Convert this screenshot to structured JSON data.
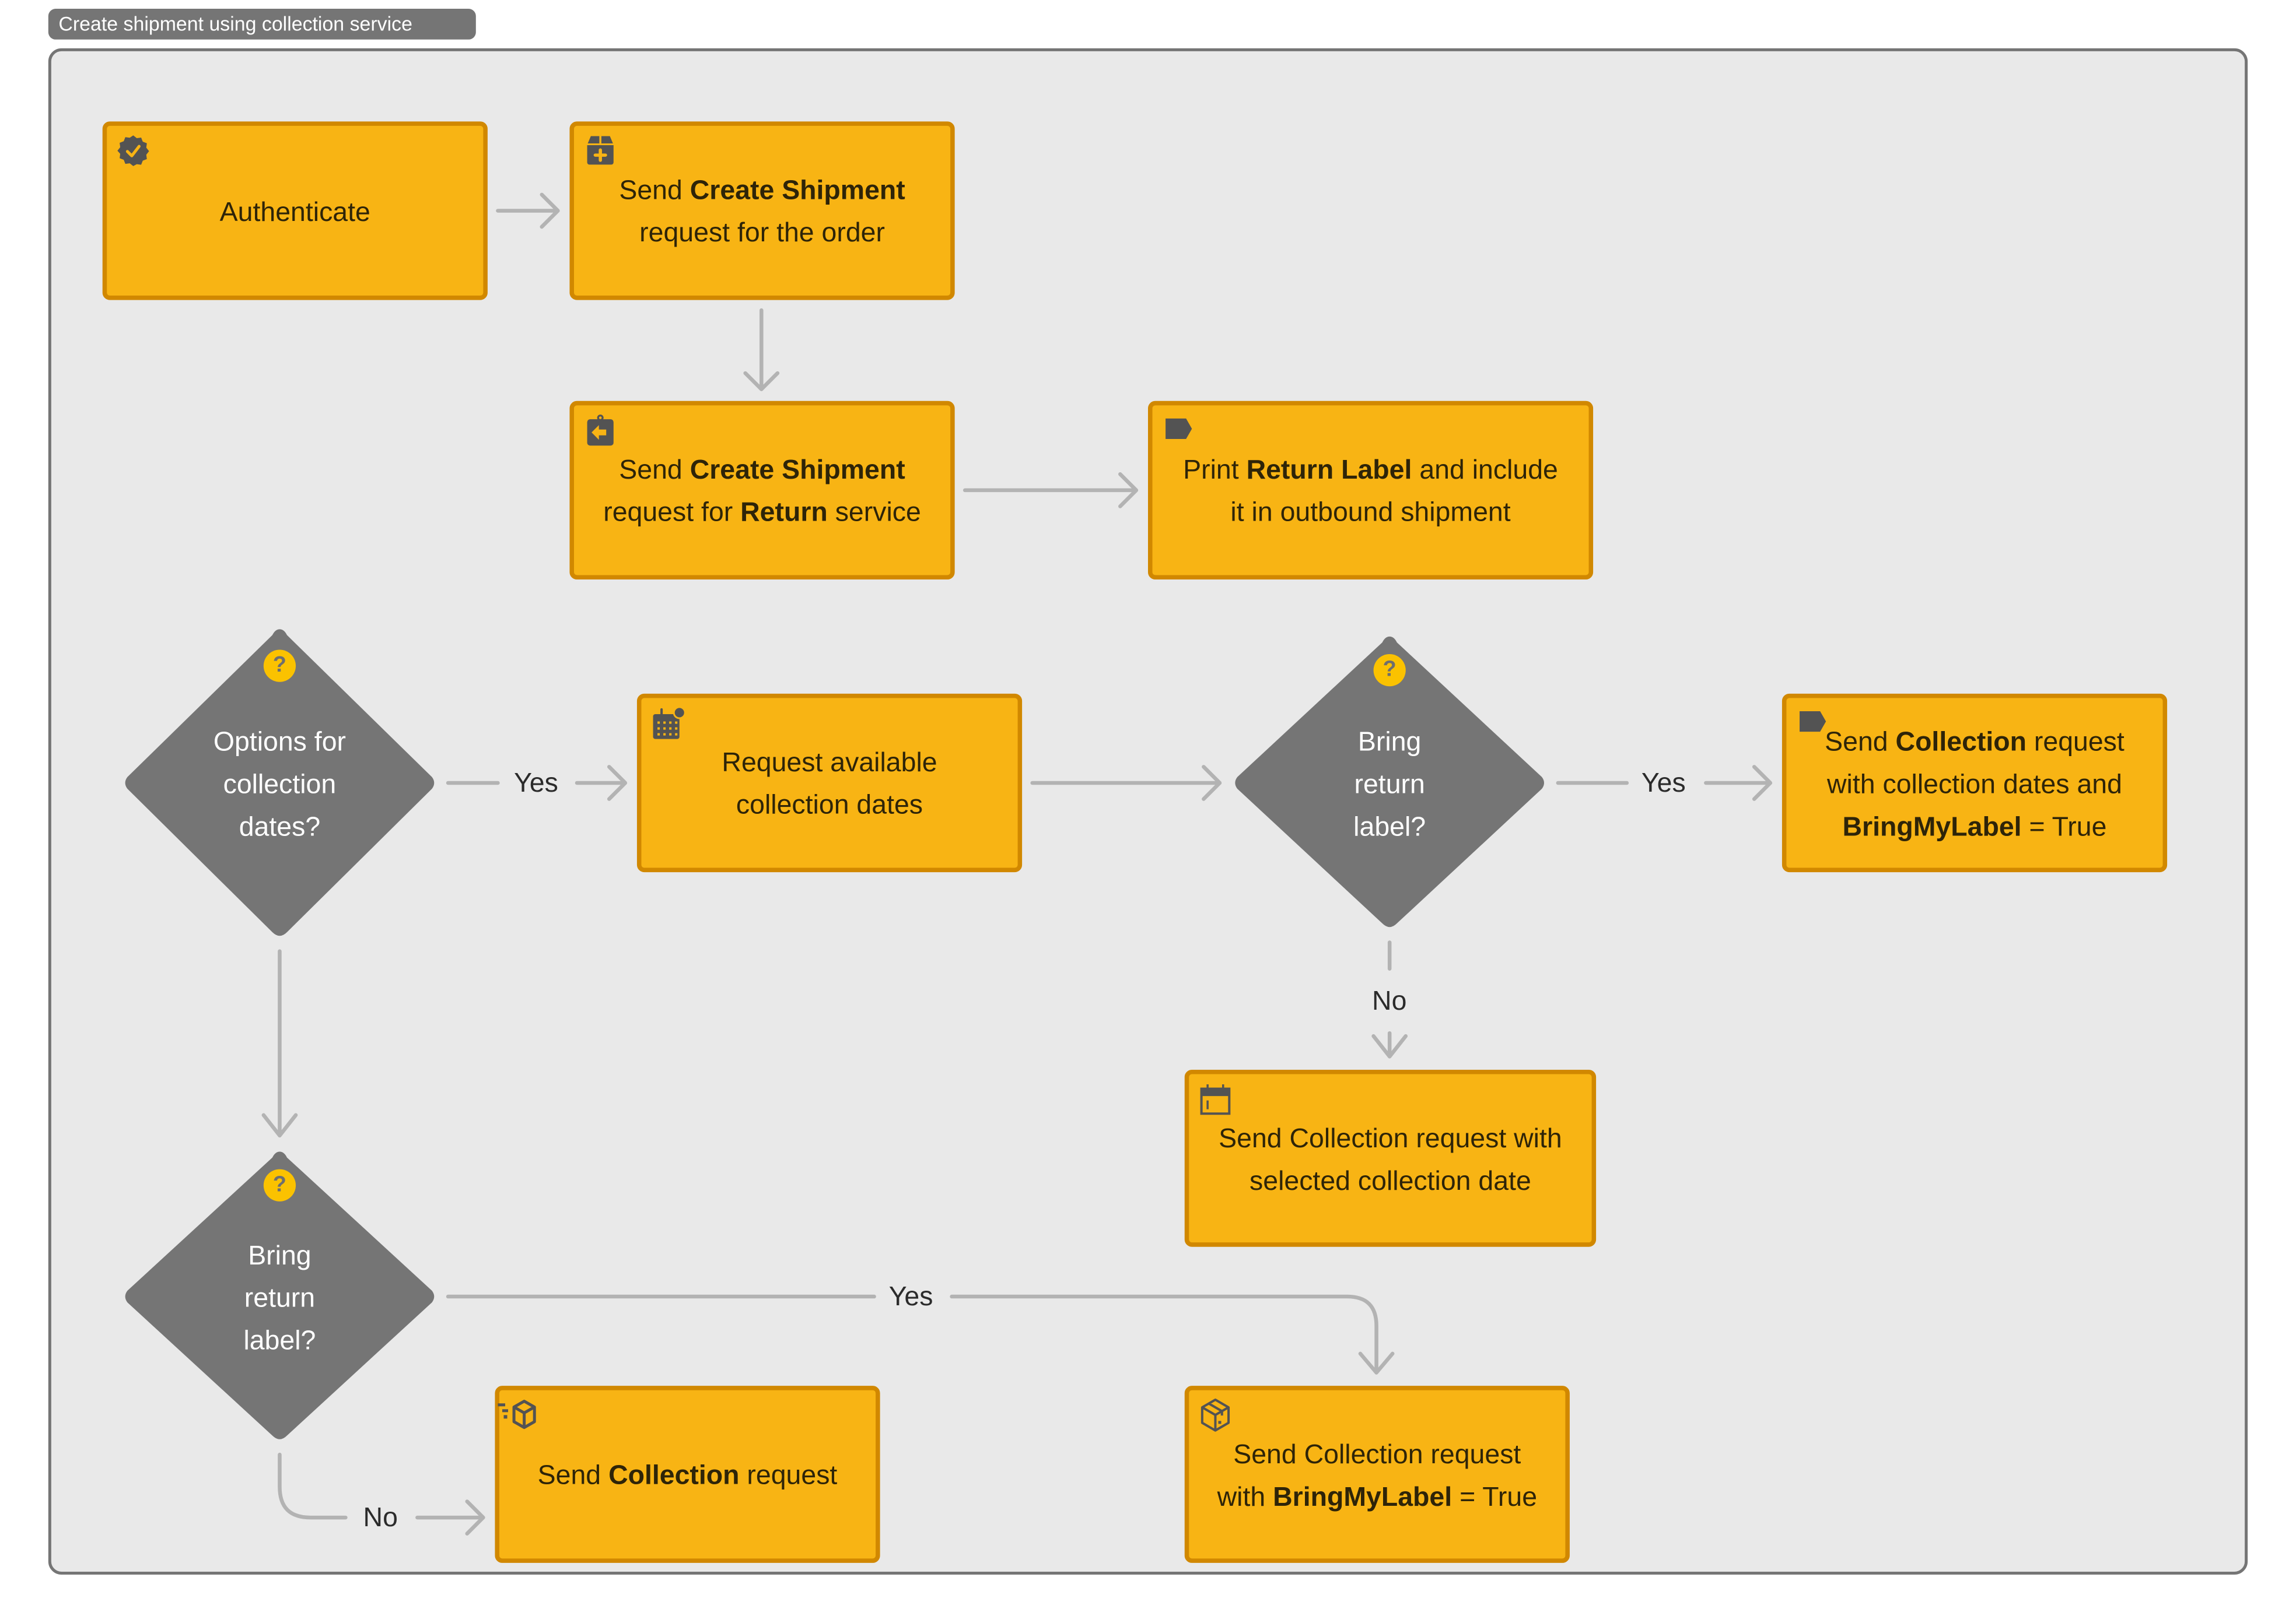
{
  "diagram": {
    "title": "Create shipment using collection service",
    "colors": {
      "process_fill": "#f8b414",
      "process_border": "#d18800",
      "decision_fill": "#757575",
      "connector": "#b3b3b3",
      "frame_bg": "#e9e9e9",
      "frame_border": "#757575",
      "icon": "#535353",
      "question_badge": "#fbc200"
    },
    "nodes": {
      "authenticate": {
        "icon": "verified-badge-icon",
        "lines": [
          [
            {
              "t": "Authenticate",
              "b": false
            }
          ]
        ]
      },
      "create_shipment": {
        "icon": "package-add-icon",
        "lines": [
          [
            {
              "t": "Send ",
              "b": false
            },
            {
              "t": "Create Shipment",
              "b": true
            }
          ],
          [
            {
              "t": "request for the order",
              "b": false
            }
          ]
        ]
      },
      "create_return_shipment": {
        "icon": "clipboard-return-icon",
        "lines": [
          [
            {
              "t": "Send ",
              "b": false
            },
            {
              "t": "Create Shipment",
              "b": true
            }
          ],
          [
            {
              "t": "request for ",
              "b": false
            },
            {
              "t": "Return",
              "b": true
            },
            {
              "t": " service",
              "b": false
            }
          ]
        ]
      },
      "print_return_label": {
        "icon": "label-tag-icon",
        "lines": [
          [
            {
              "t": "Print ",
              "b": false
            },
            {
              "t": "Return Label",
              "b": true
            },
            {
              "t": " and include",
              "b": false
            }
          ],
          [
            {
              "t": "it in outbound shipment",
              "b": false
            }
          ]
        ]
      },
      "options_decision": {
        "lines": [
          "Options for",
          "collection",
          "dates?"
        ]
      },
      "request_dates": {
        "icon": "calendar-notification-icon",
        "lines": [
          [
            {
              "t": "Request available",
              "b": false
            }
          ],
          [
            {
              "t": "collection dates",
              "b": false
            }
          ]
        ]
      },
      "bring_label_decision_1": {
        "lines": [
          "Bring",
          "return",
          "label?"
        ]
      },
      "send_collection_dates_label": {
        "icon": "label-tag-icon",
        "lines": [
          [
            {
              "t": "Send ",
              "b": false
            },
            {
              "t": "Collection",
              "b": true
            },
            {
              "t": " request",
              "b": false
            }
          ],
          [
            {
              "t": "with collection dates and",
              "b": false
            }
          ],
          [
            {
              "t": "BringMyLabel",
              "b": true
            },
            {
              "t": " = True",
              "b": false
            }
          ]
        ]
      },
      "send_collection_selected_date": {
        "icon": "calendar-icon",
        "lines": [
          [
            {
              "t": "Send Collection request with",
              "b": false
            }
          ],
          [
            {
              "t": "selected collection date",
              "b": false
            }
          ]
        ]
      },
      "bring_label_decision_2": {
        "lines": [
          "Bring",
          "return",
          "label?"
        ]
      },
      "send_collection": {
        "icon": "fast-delivery-box-icon",
        "lines": [
          [
            {
              "t": "Send ",
              "b": false
            },
            {
              "t": "Collection",
              "b": true
            },
            {
              "t": " request",
              "b": false
            }
          ]
        ]
      },
      "send_collection_label": {
        "icon": "package-box-icon",
        "lines": [
          [
            {
              "t": "Send Collection request",
              "b": false
            }
          ],
          [
            {
              "t": "with ",
              "b": false
            },
            {
              "t": "BringMyLabel",
              "b": true
            },
            {
              "t": " = True",
              "b": false
            }
          ]
        ]
      }
    },
    "edge_labels": {
      "options_yes": "Yes",
      "bring1_yes": "Yes",
      "bring1_no": "No",
      "bring2_yes": "Yes",
      "bring2_no": "No"
    },
    "question_mark": "?"
  }
}
